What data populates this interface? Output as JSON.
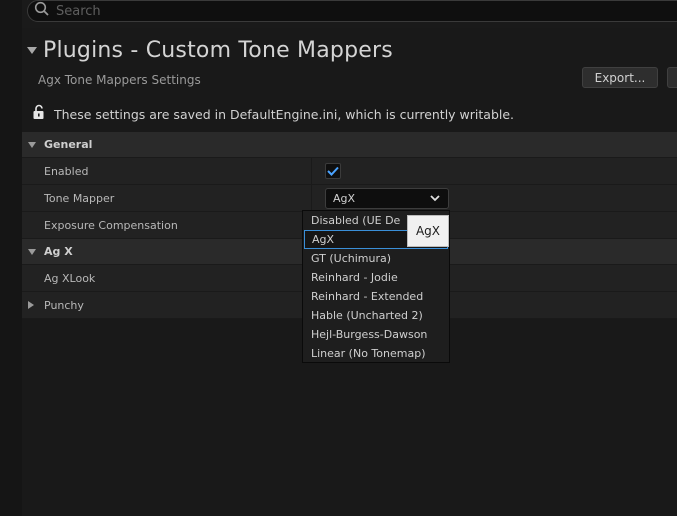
{
  "search": {
    "placeholder": "Search"
  },
  "header": {
    "title": "Plugins - Custom Tone Mappers",
    "subtitle": "Agx Tone Mappers Settings",
    "export_label": "Export...",
    "writable_text": "These settings are saved in DefaultEngine.ini, which is currently writable."
  },
  "sections": {
    "general": {
      "label": "General",
      "enabled_label": "Enabled",
      "enabled_value": true,
      "tone_mapper_label": "Tone Mapper",
      "tone_mapper_value": "AgX",
      "exposure_label": "Exposure Compensation"
    },
    "agx": {
      "label": "Ag X",
      "xlook_label": "Ag XLook",
      "punchy_label": "Punchy"
    }
  },
  "dropdown": {
    "options": [
      "Disabled (UE De",
      "AgX",
      "GT (Uchimura)",
      "Reinhard - Jodie",
      "Reinhard - Extended",
      "Hable (Uncharted 2)",
      "Hejl-Burgess-Dawson",
      "Linear (No Tonemap)"
    ],
    "selected_index": 1,
    "tooltip": "AgX"
  },
  "colors": {
    "accent": "#3a8fd8",
    "check": "#4aa3ff"
  }
}
